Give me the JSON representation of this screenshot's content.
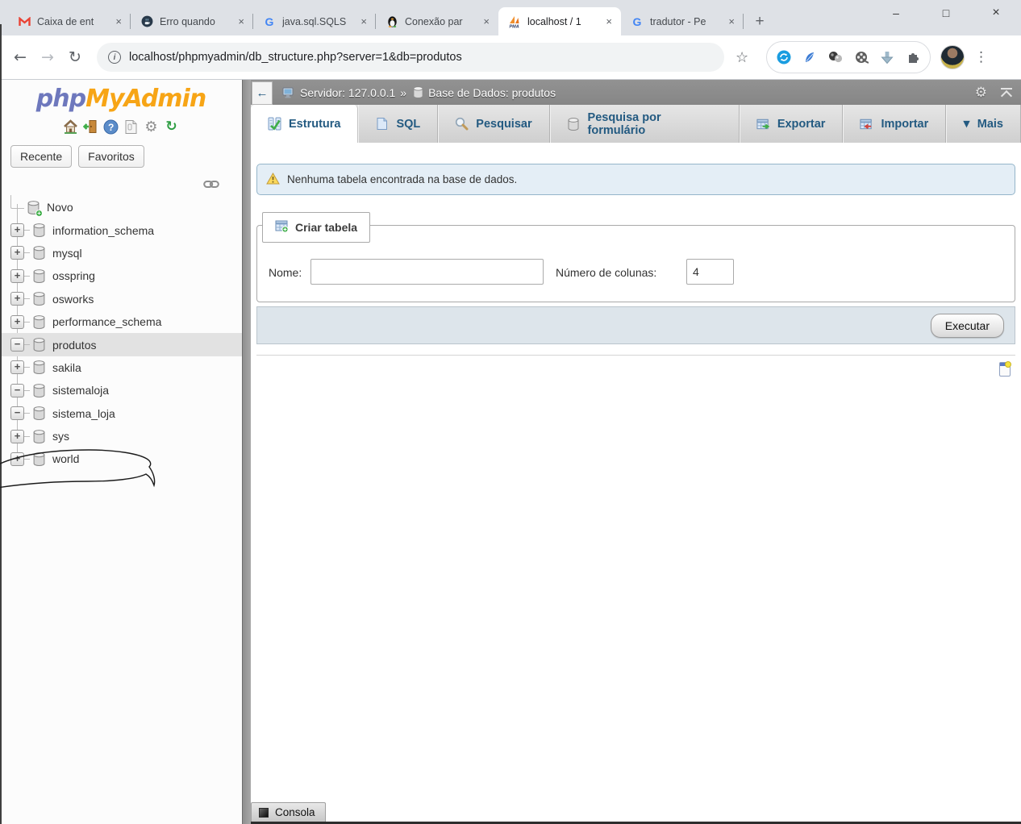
{
  "browser": {
    "tabs": [
      {
        "title": "Caixa de ent",
        "close": "×"
      },
      {
        "title": "Erro quando",
        "close": "×"
      },
      {
        "title": "java.sql.SQLS",
        "close": "×"
      },
      {
        "title": "Conexão par",
        "close": "×"
      },
      {
        "title": "localhost / 1",
        "close": "×"
      },
      {
        "title": "tradutor - Pe",
        "close": "×"
      }
    ],
    "new_tab_label": "+",
    "window_controls": {
      "minimize": "–",
      "maximize": "□",
      "close": "×"
    },
    "nav": {
      "back": "←",
      "forward": "→",
      "reload": "↻",
      "bookmark_star": "☆",
      "menu_dots": "⋮",
      "info": "i"
    },
    "url": "localhost/phpmyadmin/db_structure.php?server=1&db=produtos"
  },
  "sidebar": {
    "logo_php": "php",
    "logo_myadmin": "MyAdmin",
    "recent_button": "Recente",
    "favorites_button": "Favoritos",
    "tree": [
      {
        "label": "Novo",
        "expander": ""
      },
      {
        "label": "information_schema",
        "expander": "+"
      },
      {
        "label": "mysql",
        "expander": "+"
      },
      {
        "label": "osspring",
        "expander": "+"
      },
      {
        "label": "osworks",
        "expander": "+"
      },
      {
        "label": "performance_schema",
        "expander": "+"
      },
      {
        "label": "produtos",
        "expander": "−"
      },
      {
        "label": "sakila",
        "expander": "+"
      },
      {
        "label": "sistemaloja",
        "expander": "−"
      },
      {
        "label": "sistema_loja",
        "expander": "−"
      },
      {
        "label": "sys",
        "expander": "+"
      },
      {
        "label": "world",
        "expander": "+"
      }
    ],
    "new_db_plus": "+"
  },
  "main": {
    "breadcrumb": {
      "server": "Servidor: 127.0.0.1",
      "separator": "»",
      "database": "Base de Dados: produtos",
      "gear": "⚙"
    },
    "tabs": [
      {
        "label": "Estrutura"
      },
      {
        "label": "SQL"
      },
      {
        "label": "Pesquisar"
      },
      {
        "label": "Pesquisa por formulário"
      },
      {
        "label": "Exportar"
      },
      {
        "label": "Importar"
      },
      {
        "label": "Mais",
        "arrow": "▼"
      }
    ],
    "warning": "Nenhuma tabela encontrada na base de dados.",
    "create_table": {
      "legend": "Criar tabela",
      "name_label": "Nome:",
      "name_value": "",
      "columns_label": "Número de colunas:",
      "columns_value": "4",
      "execute_button": "Executar"
    },
    "console_label": "Consola"
  },
  "colors": {
    "logo_php": "#6e78bd",
    "logo_myadmin": "#f7a516",
    "tab_text": "#235a81"
  }
}
